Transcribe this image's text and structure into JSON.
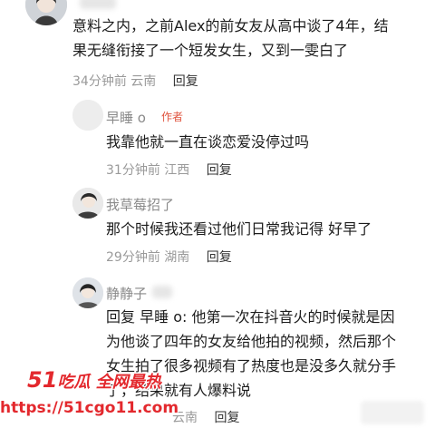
{
  "comments": [
    {
      "name": "",
      "text_line1": "意料之内，之前Alex的前女友从高中谈了4年，结",
      "text_line2": "果无缝衔接了一个短发女生，又到一雯白了",
      "time": "34分钟前",
      "location": "云南",
      "reply_label": "回复"
    },
    {
      "name": "早睡 o",
      "author_tag": "作者",
      "text_line1": "我靠他就一直在谈恋爱没停过吗",
      "time": "31分钟前",
      "location": "江西",
      "reply_label": "回复"
    },
    {
      "name": "我草莓招了",
      "text_line1": "那个时候我还看过他们日常我记得 好早了",
      "time": "29分钟前",
      "location": "湖南",
      "reply_label": "回复"
    },
    {
      "name": "静静子",
      "reply_prefix": "回复",
      "reply_target": "早睡 o",
      "text_line1": ": 他第一次在抖音火的时候就是因",
      "text_line2": "为他谈了四年的女友给他拍的视频，然后那个",
      "text_line3": "女生拍了很多视频有了热度也是没多久就分手",
      "text_line4": "了，结果就有人爆料说",
      "time": "",
      "location": "云南",
      "reply_label": "回复"
    }
  ],
  "watermark": {
    "brand_number": "51",
    "brand_text": "吃瓜 全网最热",
    "url": "https://51cgo11.com"
  },
  "colors": {
    "author_tag": "#e0543f",
    "watermark": "#e3282d",
    "meta": "#9a9a9a",
    "name": "#8a8a8a"
  }
}
